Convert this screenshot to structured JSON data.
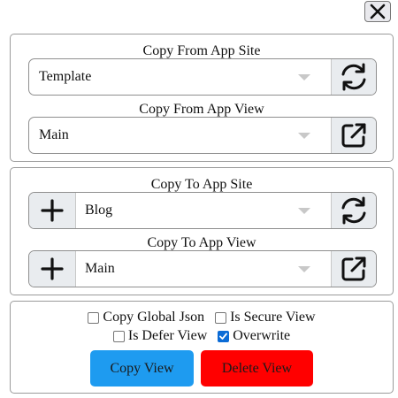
{
  "close_label": "Close",
  "copy_from": {
    "site_label": "Copy From App Site",
    "site_value": "Template",
    "view_label": "Copy From App View",
    "view_value": "Main"
  },
  "copy_to": {
    "site_label": "Copy To App Site",
    "site_value": "Blog",
    "view_label": "Copy To App View",
    "view_value": "Main"
  },
  "options": {
    "copy_global_json": {
      "label": "Copy Global Json",
      "checked": false
    },
    "is_secure_view": {
      "label": "Is Secure View",
      "checked": false
    },
    "is_defer_view": {
      "label": "Is Defer View",
      "checked": false
    },
    "overwrite": {
      "label": "Overwrite",
      "checked": true
    }
  },
  "buttons": {
    "copy_view": "Copy View",
    "delete_view": "Delete View"
  },
  "icons": {
    "close": "close-icon",
    "refresh": "refresh-icon",
    "open_external": "open-external-icon",
    "plus": "plus-icon"
  },
  "colors": {
    "copy_button": "#1e9bf0",
    "delete_button": "#ff0000",
    "checkbox_checked": "#0b6bd6"
  }
}
